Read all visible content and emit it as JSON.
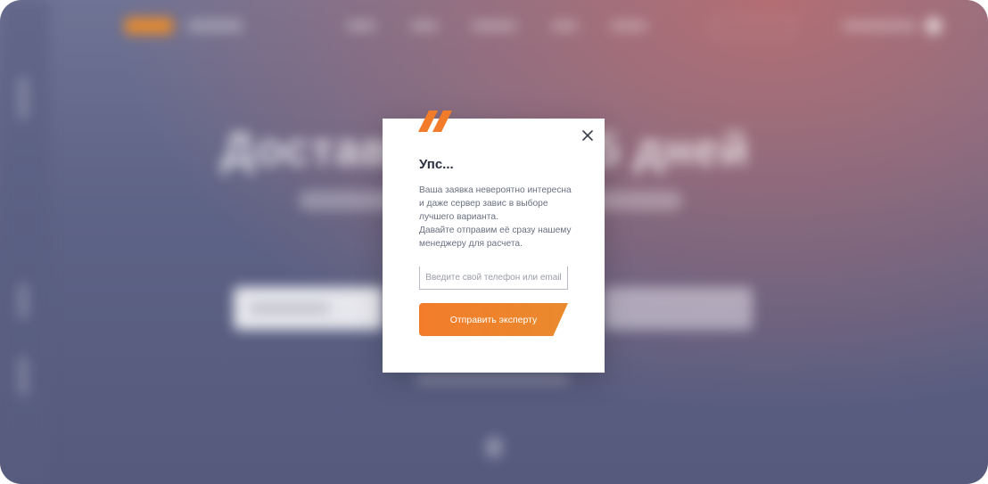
{
  "background": {
    "hero_title": "Доставим … за 5 дней"
  },
  "modal": {
    "title": "Упс...",
    "message_lines": [
      "Ваша заявка невероятно интересна",
      "и даже сервер завис в выборе",
      "лучшего варианта.",
      "Давайте отправим её сразу нашему",
      "менеджеру для расчета."
    ],
    "input_placeholder": "Введите свой телефон или email",
    "submit_label": "Отправить эксперту",
    "close_icon": "close-icon",
    "decor_icon": "double-stripe-icon"
  },
  "colors": {
    "accent": "#f27c2a",
    "overlay_top": "#b36e73",
    "overlay_base": "#5d6386",
    "text_title": "#2b2f3e",
    "text_body": "#6a7080"
  }
}
